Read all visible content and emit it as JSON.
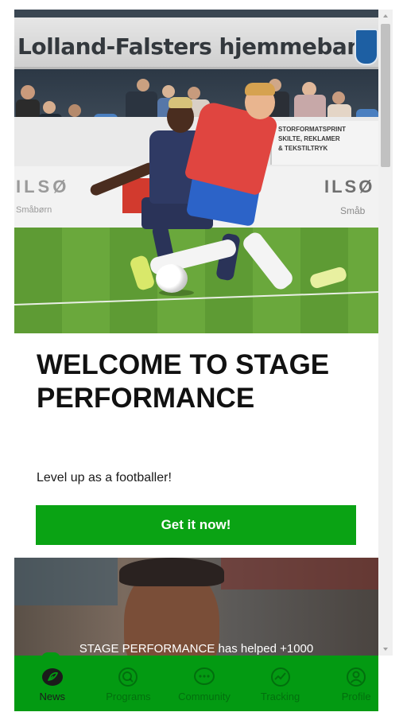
{
  "hero": {
    "banner_text": "Lolland-Falsters hjemmebane",
    "board_lines": [
      "STORFORMATSPRINT",
      "SKILTE, REKLAMER",
      "& TEKSTILTRYK"
    ],
    "ad_left": "ILSØ",
    "ad_left_sub": "Småbørn",
    "ad_right": "ILSØ",
    "ad_right_sub": "Småb"
  },
  "main": {
    "title": "WELCOME TO STAGE PERFORMANCE",
    "subtitle": "Level up as a footballer!",
    "cta_label": "Get it now!"
  },
  "promo": {
    "caption": "STAGE PERFORMANCE has helped +1000"
  },
  "nav": {
    "items": [
      {
        "label": "News",
        "icon": "news-icon",
        "active": true
      },
      {
        "label": "Programs",
        "icon": "programs-icon",
        "active": false
      },
      {
        "label": "Community",
        "icon": "community-icon",
        "active": false
      },
      {
        "label": "Tracking",
        "icon": "tracking-icon",
        "active": false
      },
      {
        "label": "Profile",
        "icon": "profile-icon",
        "active": false
      }
    ]
  },
  "colors": {
    "accent_green": "#0aa314",
    "nav_green": "#039a12"
  }
}
